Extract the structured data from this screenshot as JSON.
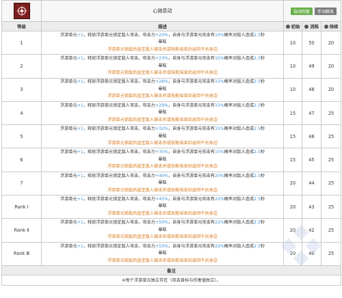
{
  "header": {
    "skill_name": "心随意动",
    "tag_auto": "自动回复",
    "tag_manual": "手动触发"
  },
  "columns": {
    "level": "等级",
    "desc": "描述",
    "initial": "初始",
    "cost": "消耗",
    "duration": "持续"
  },
  "desc_text": {
    "p1": "浮游单元",
    "p2": "，释放浮游单元锁定敌人攻击，攻击力",
    "p3": "，自身与浮游单元攻击有",
    "p4": "概率对敌人造成",
    "p5": "秒",
    "stun": "晕眩",
    "extra": "浮游单元锁敌后直至敌人被击杀或技能结束后返回干员身边"
  },
  "rows": [
    {
      "level": "1",
      "units": "+1",
      "atk": "+20%",
      "chance": "15%",
      "sec": "2.5",
      "initial": "10",
      "cost": "50",
      "duration": "20"
    },
    {
      "level": "2",
      "units": "+1",
      "atk": "+23%",
      "chance": "15%",
      "sec": "2.5",
      "initial": "10",
      "cost": "49",
      "duration": "20"
    },
    {
      "level": "3",
      "units": "+1",
      "atk": "+26%",
      "chance": "15%",
      "sec": "2.5",
      "initial": "10",
      "cost": "48",
      "duration": "20"
    },
    {
      "level": "4",
      "units": "+1",
      "atk": "+29%",
      "chance": "15%",
      "sec": "2.5",
      "initial": "15",
      "cost": "47",
      "duration": "25"
    },
    {
      "level": "5",
      "units": "+1",
      "atk": "+32%",
      "chance": "15%",
      "sec": "2.5",
      "initial": "15",
      "cost": "46",
      "duration": "25"
    },
    {
      "level": "6",
      "units": "+1",
      "atk": "+35%",
      "chance": "15%",
      "sec": "2.5",
      "initial": "15",
      "cost": "45",
      "duration": "25"
    },
    {
      "level": "7",
      "units": "+1",
      "atk": "+40%",
      "chance": "20%",
      "sec": "2.5",
      "initial": "20",
      "cost": "44",
      "duration": "25"
    },
    {
      "level": "Rank Ⅰ",
      "units": "+1",
      "atk": "+45%",
      "chance": "22%",
      "sec": "2.5",
      "initial": "20",
      "cost": "43",
      "duration": "25"
    },
    {
      "level": "Rank Ⅱ",
      "units": "+1",
      "atk": "+50%",
      "chance": "22%",
      "sec": "2.5",
      "initial": "20",
      "cost": "42",
      "duration": "25"
    },
    {
      "level": "Rank Ⅲ",
      "units": "+1",
      "atk": "+55%",
      "chance": "22%",
      "sec": "2.5",
      "initial": "20",
      "cost": "40",
      "duration": "25"
    }
  ],
  "notes": {
    "heading": "备注",
    "text": "※每个浮游单元独立存在（攻击目标与伤害值独立）。"
  },
  "colors": {
    "highlight_blue": "#3a8fd6",
    "highlight_orange": "#d9791b",
    "tag_auto_green": "#6ab04c",
    "tag_manual_gray": "#7d7d7d",
    "icon_red": "#7c1f1f"
  }
}
